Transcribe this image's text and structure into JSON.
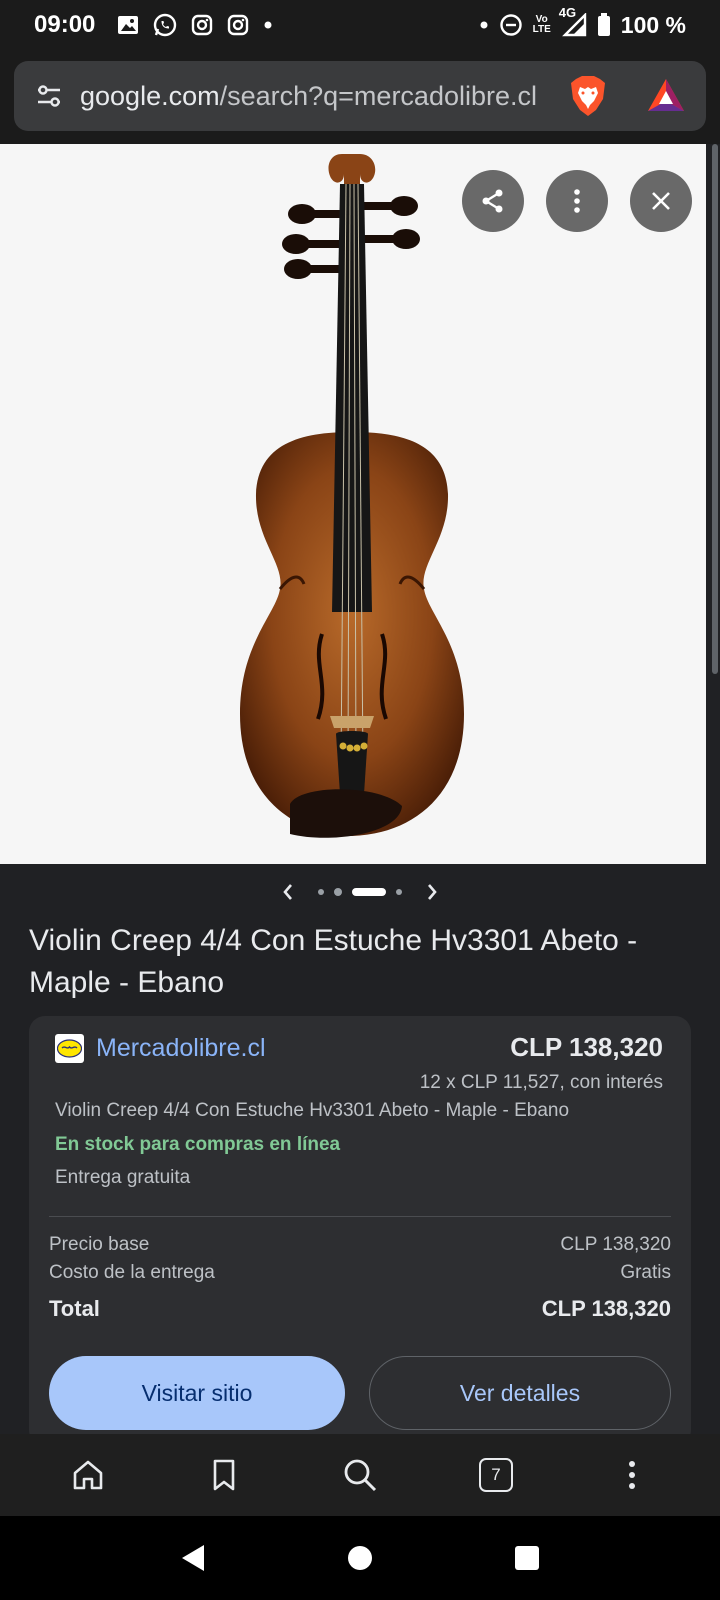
{
  "status_bar": {
    "time": "09:00",
    "network_top": "Vo",
    "network_bottom": "LTE",
    "signal_type": "4G",
    "battery": "100 %"
  },
  "browser": {
    "url_host": "google.com",
    "url_path": "/search?q=mercadolibre.cl",
    "tab_count": "7"
  },
  "image_viewer": {
    "subject": "violin",
    "carousel_dot_count": 4,
    "carousel_active_index": 2
  },
  "product": {
    "title": "Violin Creep 4/4 Con Estuche Hv3301 Abeto - Maple - Ebano"
  },
  "offer": {
    "seller": "Mercadolibre.cl",
    "price": "CLP 138,320",
    "installments": "12 x CLP 11,527, con interés",
    "description": "Violin Creep 4/4 Con Estuche Hv3301 Abeto - Maple - Ebano",
    "stock": "En stock para compras en línea",
    "delivery": "Entrega gratuita",
    "breakdown": [
      {
        "label": "Precio base",
        "value": "CLP 138,320"
      },
      {
        "label": "Costo de la entrega",
        "value": "Gratis"
      }
    ],
    "total_label": "Total",
    "total_value": "CLP 138,320",
    "visit_label": "Visitar sitio",
    "details_label": "Ver detalles"
  },
  "colors": {
    "accent_link": "#8ab4f8",
    "stock_green": "#81c995",
    "primary_button": "#a8c7fa",
    "card_bg": "#2d2e31",
    "page_bg": "#202124"
  },
  "icons": {
    "url_bar_left": "tune-icon",
    "brave": "brave-lion-icon",
    "bat": "bat-rewards-icon",
    "share": "share-icon",
    "more": "more-vert-icon",
    "close": "close-icon",
    "home": "home-icon",
    "bookmark": "bookmark-icon",
    "search": "search-icon",
    "tabs": "tabs-icon",
    "menu": "more-vert-icon",
    "back": "nav-back-icon",
    "nav_home": "nav-home-icon",
    "recents": "nav-recents-icon"
  }
}
